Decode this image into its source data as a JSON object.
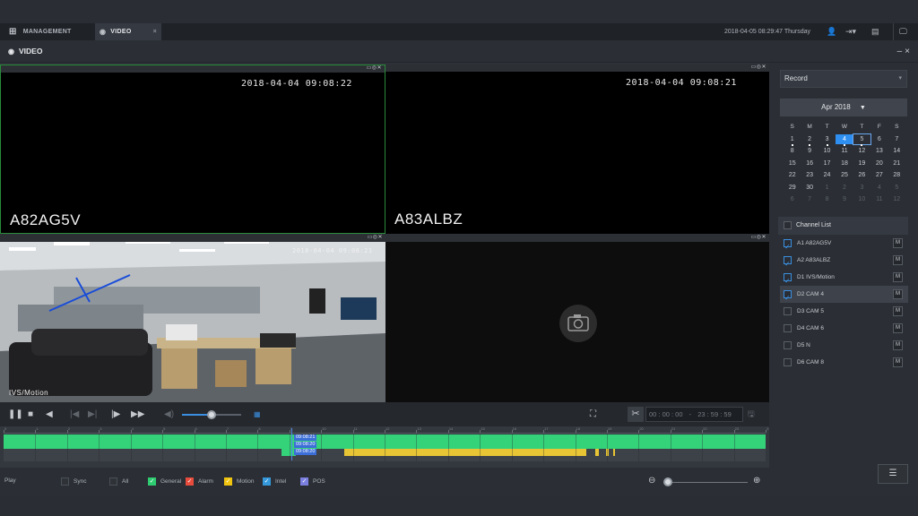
{
  "tabs": [
    {
      "label": "MANAGEMENT",
      "icon": "grid-icon"
    },
    {
      "label": "VIDEO",
      "icon": "video-icon",
      "close": "×"
    }
  ],
  "header": {
    "datetime": "2018-04-05 08:29:47 Thursday"
  },
  "window": {
    "title": "VIDEO",
    "min": "–",
    "close": "×"
  },
  "panes": [
    {
      "timestamp": "2018-04-04 09:08:22",
      "camera": "A82AG5V"
    },
    {
      "timestamp": "2018-04-04 09:08:21",
      "camera": "A83ALBZ"
    },
    {
      "timestamp": "2018-04-04 09:08:21",
      "camera": "IVS/Motion"
    },
    {
      "timestamp": "",
      "camera": ""
    }
  ],
  "controls": {
    "time_start": "00 : 00 : 00",
    "time_sep": "-",
    "time_end": "23 : 59 : 59",
    "volume": 0.5
  },
  "timeline": {
    "cursor_times": [
      "09:08:21",
      "09:08:20",
      "09:08:20"
    ],
    "hour_ticks": [
      "0",
      "1",
      "2",
      "3",
      "4",
      "5",
      "6",
      "7",
      "8",
      "9",
      "10",
      "11",
      "12",
      "13",
      "14",
      "15",
      "16",
      "17",
      "18",
      "19",
      "20",
      "21",
      "22",
      "23",
      "24"
    ]
  },
  "legend": {
    "play": "Play",
    "items": [
      {
        "label": "Sync",
        "color": "#2f3338",
        "checked": false
      },
      {
        "label": "All",
        "color": "#2f3338",
        "checked": false
      },
      {
        "label": "General",
        "color": "#2ecc71",
        "checked": true
      },
      {
        "label": "Alarm",
        "color": "#e74c3c",
        "checked": true
      },
      {
        "label": "Motion",
        "color": "#f1c40f",
        "checked": true
      },
      {
        "label": "Intel",
        "color": "#3498db",
        "checked": true
      },
      {
        "label": "POS",
        "color": "#7b7fe0",
        "checked": true
      }
    ]
  },
  "right_panel": {
    "record_type": "Record",
    "calendar": {
      "month": "Apr 2018",
      "weekdays": [
        "S",
        "M",
        "T",
        "W",
        "T",
        "F",
        "S"
      ],
      "days": [
        [
          "1",
          "2",
          "3",
          "4",
          "5",
          "6",
          "7"
        ],
        [
          "8",
          "9",
          "10",
          "11",
          "12",
          "13",
          "14"
        ],
        [
          "15",
          "16",
          "17",
          "18",
          "19",
          "20",
          "21"
        ],
        [
          "22",
          "23",
          "24",
          "25",
          "26",
          "27",
          "28"
        ],
        [
          "29",
          "30",
          "1",
          "2",
          "3",
          "4",
          "5"
        ],
        [
          "6",
          "7",
          "8",
          "9",
          "10",
          "11",
          "12"
        ]
      ],
      "selected_day": "4",
      "today": "5"
    },
    "channel_list_label": "Channel List",
    "channels": [
      {
        "label": "A1 A82AG5V",
        "checked": true,
        "m": "M"
      },
      {
        "label": "A2 A83ALBZ",
        "checked": true,
        "m": "M"
      },
      {
        "label": "D1 IVS/Motion",
        "checked": true,
        "m": "M"
      },
      {
        "label": "D2 CAM 4",
        "checked": true,
        "m": "M"
      },
      {
        "label": "D3 CAM 5",
        "checked": false,
        "m": "M"
      },
      {
        "label": "D4 CAM 6",
        "checked": false,
        "m": "M"
      },
      {
        "label": "D5 N",
        "checked": false,
        "m": "M"
      },
      {
        "label": "D6 CAM 8",
        "checked": false,
        "m": "M"
      }
    ]
  }
}
